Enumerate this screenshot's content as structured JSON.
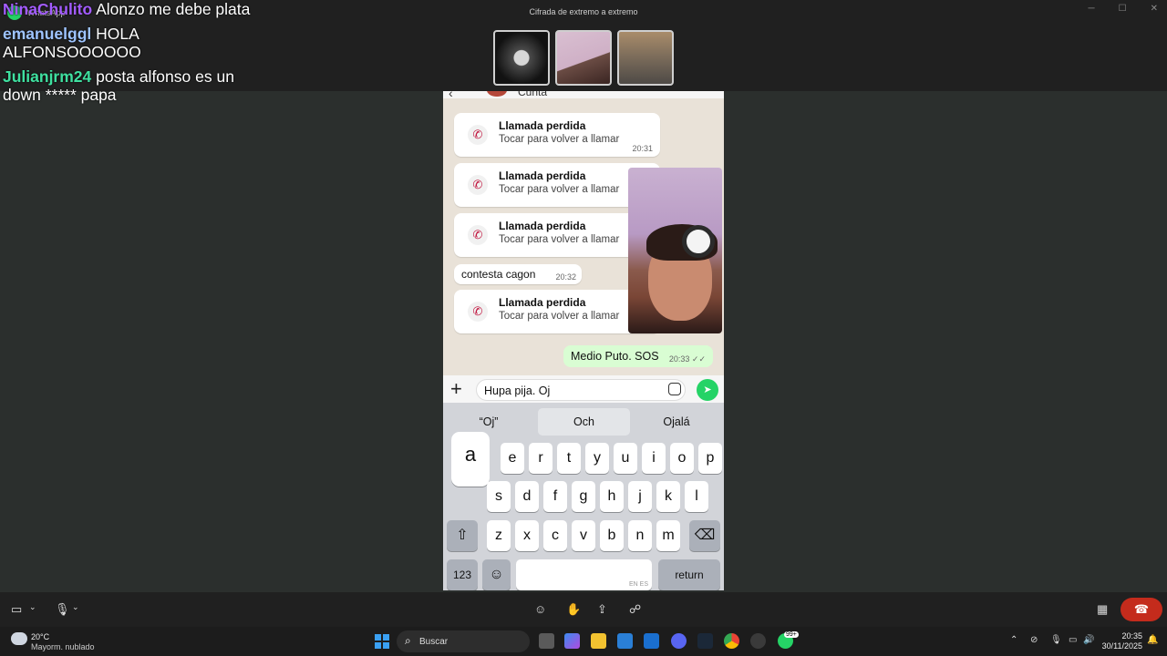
{
  "window": {
    "app_title": "WhatsApp",
    "encryption_label": "Cifrada de extremo a extremo",
    "controls": [
      "─",
      "☐",
      "✕"
    ]
  },
  "chat_overlay": [
    {
      "user": "NinaChulito",
      "text": "Alonzo me debe plata"
    },
    {
      "user": "emanuelggl",
      "text": "HOLA ALFONSOOOOOO"
    },
    {
      "user": "Julianjrm24",
      "text": "posta alfonso es un down ***** papa"
    }
  ],
  "phone": {
    "contact_name": "Cunta",
    "messages": {
      "missed_title": "Llamada perdida",
      "missed_subtitle": "Tocar para volver a llamar",
      "missed1_time": "20:31",
      "text_in": "contesta cagon",
      "text_in_time": "20:32",
      "text_out": "Medio Puto. SOS",
      "text_out_time": "20:33",
      "read_ticks": "✓✓"
    },
    "input_value": "Hupa pija. Oj",
    "suggestions": [
      "“Oj”",
      "Och",
      "Ojalá"
    ],
    "keys": {
      "row1": [
        "e",
        "r",
        "t",
        "y",
        "u",
        "i",
        "o",
        "p"
      ],
      "row2": [
        "s",
        "d",
        "f",
        "g",
        "h",
        "j",
        "k",
        "l"
      ],
      "row3": [
        "z",
        "x",
        "c",
        "v",
        "b",
        "n",
        "m"
      ],
      "popup": "a",
      "numbers": "123",
      "return": "return",
      "space_lang": "EN ES"
    }
  },
  "taskbar": {
    "temperature": "20°C",
    "weather_desc": "Mayorm. nublado",
    "search_placeholder": "Buscar",
    "time": "20:35",
    "date": "30/11/2025",
    "badge_count": "99+"
  }
}
